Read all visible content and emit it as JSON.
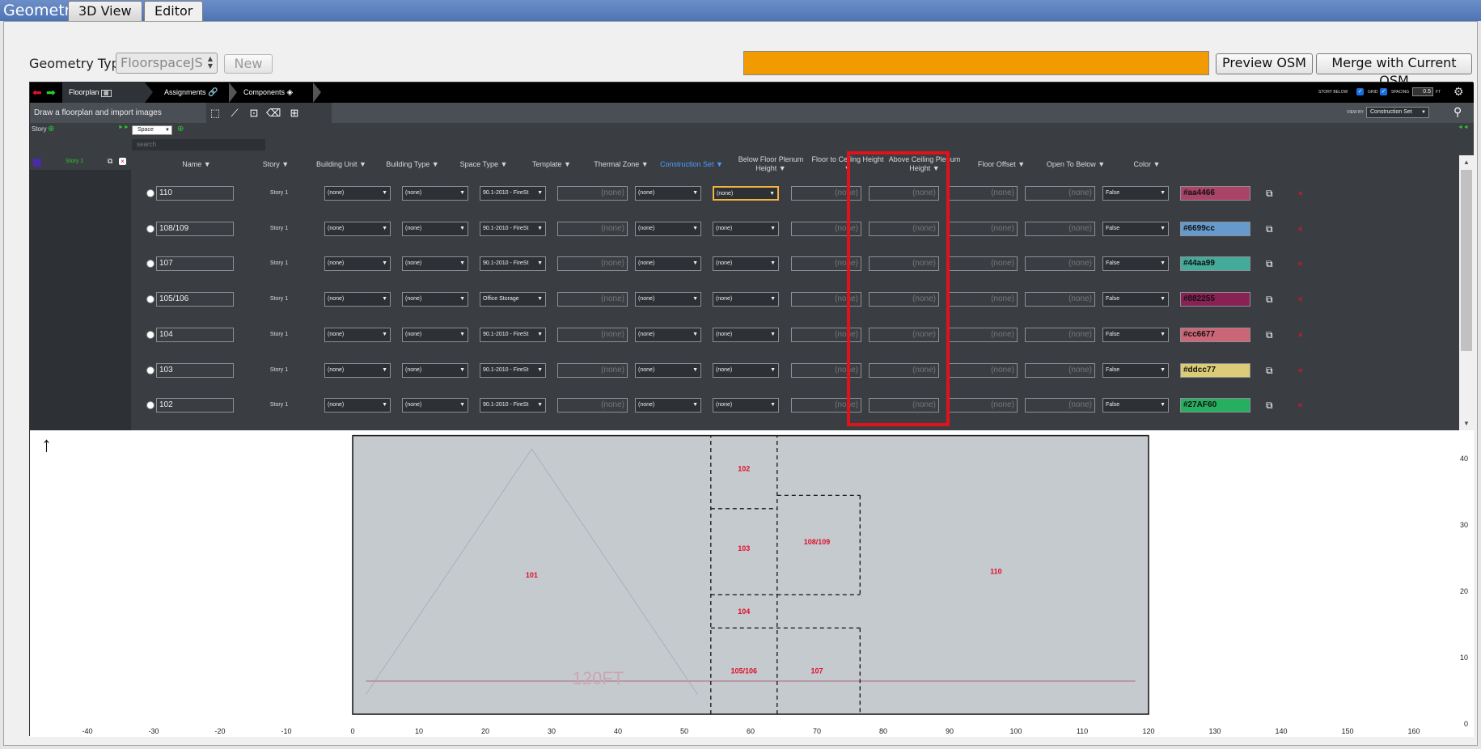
{
  "app_title": "Geometry",
  "tabs": [
    {
      "label": "3D View"
    },
    {
      "label": "Editor"
    }
  ],
  "geometry_type": {
    "label": "Geometry Type",
    "value": "FloorspaceJS",
    "new_label": "New"
  },
  "progress_fraction": 1.0,
  "buttons": {
    "preview": "Preview OSM",
    "merge": "Merge with Current OSM"
  },
  "nav": {
    "steps": [
      "Floorplan",
      "Assignments",
      "Components"
    ],
    "story_below": "STORY BELOW",
    "grid": "GRID",
    "spacing": "SPACING",
    "spacing_value": "0.5",
    "spacing_unit": "FT",
    "view_by": "VIEW BY",
    "view_by_value": "Construction Set"
  },
  "toolbar": {
    "hint": "Draw a floorplan and import images"
  },
  "sidebar": {
    "story_label": "Story",
    "space_select": "Space",
    "search_placeholder": "search",
    "story_item": "Story 1"
  },
  "columns": [
    "Name ▼",
    "Story ▼",
    "Building Unit ▼",
    "Building Type ▼",
    "Space Type ▼",
    "Template ▼",
    "Thermal Zone ▼",
    "Construction Set ▼",
    "Below Floor Plenum Height ▼",
    "Floor to Ceiling Height ▼",
    "Above Ceiling Plenum Height ▼",
    "Floor Offset ▼",
    "Open To Below ▼",
    "Color ▼"
  ],
  "none": "(none)",
  "rows": [
    {
      "name": "110",
      "story": "Story 1",
      "unit": "(none)",
      "btype": "(none)",
      "stype": "90.1-2010 - FireSt",
      "tmpl": "(none)",
      "zone": "(none)",
      "cset": "(none)",
      "bfp": "(none)",
      "fch": "(none)",
      "acp": "(none)",
      "off": "(none)",
      "open": "False",
      "color": "#aa4466"
    },
    {
      "name": "108/109",
      "story": "Story 1",
      "unit": "(none)",
      "btype": "(none)",
      "stype": "90.1-2010 - FireSt",
      "tmpl": "(none)",
      "zone": "(none)",
      "cset": "(none)",
      "bfp": "(none)",
      "fch": "(none)",
      "acp": "(none)",
      "off": "(none)",
      "open": "False",
      "color": "#6699cc"
    },
    {
      "name": "107",
      "story": "Story 1",
      "unit": "(none)",
      "btype": "(none)",
      "stype": "90.1-2010 - FireSt",
      "tmpl": "(none)",
      "zone": "(none)",
      "cset": "(none)",
      "bfp": "(none)",
      "fch": "(none)",
      "acp": "(none)",
      "off": "(none)",
      "open": "False",
      "color": "#44aa99"
    },
    {
      "name": "105/106",
      "story": "Story 1",
      "unit": "(none)",
      "btype": "(none)",
      "stype": "Office Storage",
      "tmpl": "(none)",
      "zone": "(none)",
      "cset": "(none)",
      "bfp": "(none)",
      "fch": "(none)",
      "acp": "(none)",
      "off": "(none)",
      "open": "False",
      "color": "#882255"
    },
    {
      "name": "104",
      "story": "Story 1",
      "unit": "(none)",
      "btype": "(none)",
      "stype": "90.1-2010 - FireSt",
      "tmpl": "(none)",
      "zone": "(none)",
      "cset": "(none)",
      "bfp": "(none)",
      "fch": "(none)",
      "acp": "(none)",
      "off": "(none)",
      "open": "False",
      "color": "#cc6677"
    },
    {
      "name": "103",
      "story": "Story 1",
      "unit": "(none)",
      "btype": "(none)",
      "stype": "90.1-2010 - FireSt",
      "tmpl": "(none)",
      "zone": "(none)",
      "cset": "(none)",
      "bfp": "(none)",
      "fch": "(none)",
      "acp": "(none)",
      "off": "(none)",
      "open": "False",
      "color": "#ddcc77"
    },
    {
      "name": "102",
      "story": "Story 1",
      "unit": "(none)",
      "btype": "(none)",
      "stype": "90.1-2010 - FireSt",
      "tmpl": "(none)",
      "zone": "(none)",
      "cset": "(none)",
      "bfp": "(none)",
      "fch": "(none)",
      "acp": "(none)",
      "off": "(none)",
      "open": "False",
      "color": "#27AF60"
    }
  ],
  "floorplan": {
    "x_ticks": [
      "-40",
      "-30",
      "-20",
      "-10",
      "0",
      "10",
      "20",
      "30",
      "40",
      "50",
      "60",
      "70",
      "80",
      "90",
      "100",
      "110",
      "120",
      "130",
      "140",
      "150",
      "160"
    ],
    "y_ticks": [
      "0",
      "10",
      "20",
      "30",
      "40"
    ],
    "x_values": [
      -40,
      -30,
      -20,
      -10,
      0,
      10,
      20,
      30,
      40,
      50,
      60,
      70,
      80,
      90,
      100,
      110,
      120,
      130,
      140,
      150,
      160
    ],
    "y_values": [
      0,
      10,
      20,
      30,
      40
    ],
    "space_labels": [
      {
        "name": "101",
        "x": 27,
        "y": 21
      },
      {
        "name": "102",
        "x": 59,
        "y": 37
      },
      {
        "name": "103",
        "x": 59,
        "y": 25
      },
      {
        "name": "104",
        "x": 59,
        "y": 15.5
      },
      {
        "name": "105/106",
        "x": 59,
        "y": 6.5
      },
      {
        "name": "107",
        "x": 70,
        "y": 6.5
      },
      {
        "name": "108/109",
        "x": 70,
        "y": 26
      },
      {
        "name": "110",
        "x": 97,
        "y": 21.5
      }
    ],
    "image_text": "120FT",
    "extent": {
      "x": [
        0,
        120
      ],
      "y": [
        0,
        42
      ]
    }
  }
}
